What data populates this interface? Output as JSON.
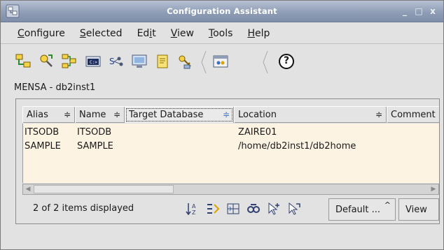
{
  "window": {
    "title": "Configuration Assistant",
    "controls": [
      "_",
      "□",
      "x"
    ]
  },
  "menubar": {
    "items": [
      {
        "mnemonic": "C",
        "rest": "onfigure"
      },
      {
        "mnemonic": "S",
        "rest": "elected"
      },
      {
        "pre": "Ed",
        "mnemonic": "i",
        "rest": "t"
      },
      {
        "mnemonic": "V",
        "rest": "iew"
      },
      {
        "mnemonic": "T",
        "rest": "ools"
      },
      {
        "mnemonic": "H",
        "rest": "elp"
      }
    ]
  },
  "toolbar": {
    "icons": [
      "add-database-icon",
      "discover-icon",
      "import-icon",
      "command-window-icon",
      "network-icon",
      "control-center-icon",
      "journal-icon",
      "license-icon",
      "command-editor-icon",
      "help-icon"
    ],
    "help_glyph": "?"
  },
  "context_label": "MENSA - db2inst1",
  "table": {
    "columns": [
      "Alias",
      "Name",
      "Target Database",
      "Location",
      "Comment"
    ],
    "sort_glyph": "≑",
    "rows": [
      {
        "alias": "ITSODB",
        "name": "ITSODB",
        "target": "",
        "location": "ZAIRE01",
        "comment": ""
      },
      {
        "alias": "SAMPLE",
        "name": "SAMPLE",
        "target": "",
        "location": "/home/db2inst1/db2home",
        "comment": ""
      }
    ]
  },
  "statusbar": {
    "items_displayed": "2 of 2 items displayed",
    "view_value": "Default ...",
    "view_caret": "^",
    "view_button": "View"
  },
  "colors": {
    "titlebar": "#8f9db6",
    "list_background": "#fdf3e3",
    "panel": "#e2e2e2"
  }
}
